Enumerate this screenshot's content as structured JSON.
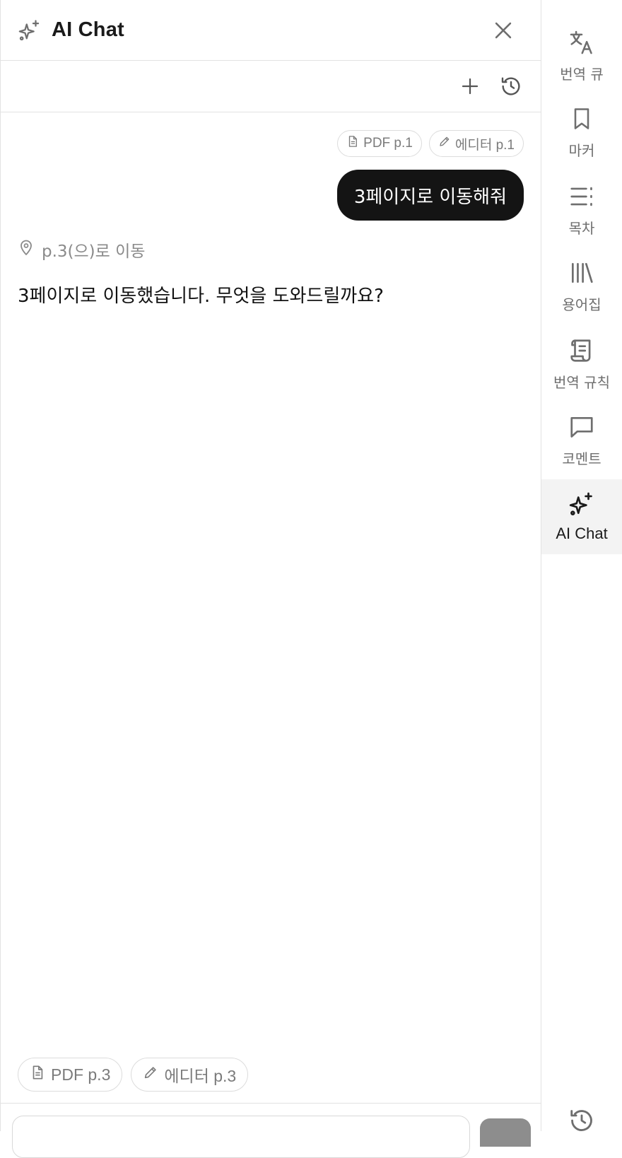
{
  "header": {
    "title": "AI Chat"
  },
  "toolbar": {
    "new_icon": "plus-icon",
    "history_icon": "history-icon"
  },
  "conversation": {
    "user_context_chips": [
      {
        "icon": "document-icon",
        "label": "PDF p.1"
      },
      {
        "icon": "pencil-icon",
        "label": "에디터 p.1"
      }
    ],
    "user_message": "3페이지로 이동해줘",
    "assistant_action": "p.3(으)로 이동",
    "assistant_message": "3페이지로 이동했습니다. 무엇을 도와드릴까요?"
  },
  "composer": {
    "context_chips": [
      {
        "icon": "document-icon",
        "label": "PDF p.3"
      },
      {
        "icon": "pencil-icon",
        "label": "에디터 p.3"
      }
    ]
  },
  "rail": {
    "items": [
      {
        "icon": "translate-icon",
        "label": "번역 큐"
      },
      {
        "icon": "bookmark-icon",
        "label": "마커"
      },
      {
        "icon": "list-icon",
        "label": "목차"
      },
      {
        "icon": "library-icon",
        "label": "용어집"
      },
      {
        "icon": "scroll-icon",
        "label": "번역 규칙"
      },
      {
        "icon": "comment-icon",
        "label": "코멘트"
      },
      {
        "icon": "sparkles-icon",
        "label": "AI Chat",
        "active": true
      }
    ]
  }
}
